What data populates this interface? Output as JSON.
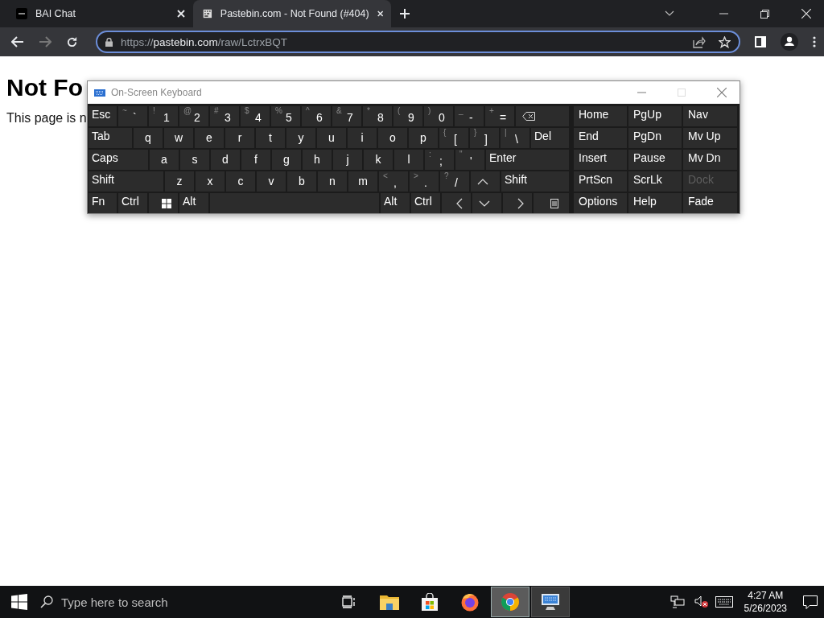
{
  "browser": {
    "tabs": [
      {
        "title": "BAI Chat",
        "selected": false
      },
      {
        "title": "Pastebin.com - Not Found (#404)",
        "selected": true
      }
    ],
    "address": {
      "scheme": "https://",
      "host": "pastebin.com",
      "path": "/raw/LctrxBQT"
    }
  },
  "page": {
    "heading": "Not Fo",
    "paragraph": "This page is n"
  },
  "keyboard": {
    "title": "On-Screen Keyboard",
    "maximize_disabled": true,
    "main_rows": [
      [
        {
          "kind": "text",
          "label": "Esc"
        },
        {
          "kind": "pair",
          "shift": "~",
          "label": "`"
        },
        {
          "kind": "pair",
          "shift": "!",
          "label": "1"
        },
        {
          "kind": "pair",
          "shift": "@",
          "label": "2"
        },
        {
          "kind": "pair",
          "shift": "#",
          "label": "3"
        },
        {
          "kind": "pair",
          "shift": "$",
          "label": "4"
        },
        {
          "kind": "pair",
          "shift": "%",
          "label": "5"
        },
        {
          "kind": "pair",
          "shift": "^",
          "label": "6"
        },
        {
          "kind": "pair",
          "shift": "&",
          "label": "7"
        },
        {
          "kind": "pair",
          "shift": "*",
          "label": "8"
        },
        {
          "kind": "pair",
          "shift": "(",
          "label": "9"
        },
        {
          "kind": "pair",
          "shift": ")",
          "label": "0"
        },
        {
          "kind": "pair",
          "shift": "_",
          "label": "-"
        },
        {
          "kind": "pair",
          "shift": "+",
          "label": "="
        },
        {
          "kind": "backspace"
        }
      ],
      [
        {
          "kind": "text",
          "label": "Tab"
        },
        {
          "kind": "letter",
          "label": "q"
        },
        {
          "kind": "letter",
          "label": "w"
        },
        {
          "kind": "letter",
          "label": "e"
        },
        {
          "kind": "letter",
          "label": "r"
        },
        {
          "kind": "letter",
          "label": "t"
        },
        {
          "kind": "letter",
          "label": "y"
        },
        {
          "kind": "letter",
          "label": "u"
        },
        {
          "kind": "letter",
          "label": "i"
        },
        {
          "kind": "letter",
          "label": "o"
        },
        {
          "kind": "letter",
          "label": "p"
        },
        {
          "kind": "pair",
          "shift": "{",
          "label": "["
        },
        {
          "kind": "pair",
          "shift": "}",
          "label": "]"
        },
        {
          "kind": "pair",
          "shift": "|",
          "label": "\\"
        },
        {
          "kind": "text",
          "label": "Del"
        }
      ],
      [
        {
          "kind": "text",
          "label": "Caps"
        },
        {
          "kind": "letter",
          "label": "a"
        },
        {
          "kind": "letter",
          "label": "s"
        },
        {
          "kind": "letter",
          "label": "d"
        },
        {
          "kind": "letter",
          "label": "f"
        },
        {
          "kind": "letter",
          "label": "g"
        },
        {
          "kind": "letter",
          "label": "h"
        },
        {
          "kind": "letter",
          "label": "j"
        },
        {
          "kind": "letter",
          "label": "k"
        },
        {
          "kind": "letter",
          "label": "l"
        },
        {
          "kind": "pair",
          "shift": ":",
          "label": ";"
        },
        {
          "kind": "pair",
          "shift": "\"",
          "label": "'"
        },
        {
          "kind": "text",
          "label": "Enter"
        }
      ],
      [
        {
          "kind": "text",
          "label": "Shift"
        },
        {
          "kind": "letter",
          "label": "z"
        },
        {
          "kind": "letter",
          "label": "x"
        },
        {
          "kind": "letter",
          "label": "c"
        },
        {
          "kind": "letter",
          "label": "v"
        },
        {
          "kind": "letter",
          "label": "b"
        },
        {
          "kind": "letter",
          "label": "n"
        },
        {
          "kind": "letter",
          "label": "m"
        },
        {
          "kind": "pair",
          "shift": "<",
          "label": ","
        },
        {
          "kind": "pair",
          "shift": ">",
          "label": "."
        },
        {
          "kind": "pair",
          "shift": "?",
          "label": "/"
        },
        {
          "kind": "up"
        },
        {
          "kind": "text",
          "label": "Shift"
        }
      ],
      [
        {
          "kind": "text",
          "label": "Fn"
        },
        {
          "kind": "text",
          "label": "Ctrl"
        },
        {
          "kind": "windows"
        },
        {
          "kind": "text",
          "label": "Alt"
        },
        {
          "kind": "space"
        },
        {
          "kind": "text",
          "label": "Alt"
        },
        {
          "kind": "text",
          "label": "Ctrl"
        },
        {
          "kind": "left"
        },
        {
          "kind": "down"
        },
        {
          "kind": "right"
        },
        {
          "kind": "menu"
        }
      ]
    ],
    "side_keys": [
      {
        "label": "Home",
        "disabled": false
      },
      {
        "label": "PgUp",
        "disabled": false
      },
      {
        "label": "Nav",
        "disabled": false
      },
      {
        "label": "End",
        "disabled": false
      },
      {
        "label": "PgDn",
        "disabled": false
      },
      {
        "label": "Mv Up",
        "disabled": false
      },
      {
        "label": "Insert",
        "disabled": false
      },
      {
        "label": "Pause",
        "disabled": false
      },
      {
        "label": "Mv Dn",
        "disabled": false
      },
      {
        "label": "PrtScn",
        "disabled": false
      },
      {
        "label": "ScrLk",
        "disabled": false
      },
      {
        "label": "Dock",
        "disabled": true
      },
      {
        "label": "Options",
        "disabled": false
      },
      {
        "label": "Help",
        "disabled": false
      },
      {
        "label": "Fade",
        "disabled": false
      }
    ]
  },
  "taskbar": {
    "search": {
      "placeholder": "Type here to search"
    },
    "apps": [
      {
        "kind": "task-view",
        "selected": false,
        "open": false
      },
      {
        "kind": "explorer",
        "selected": false,
        "open": false
      },
      {
        "kind": "store",
        "selected": false,
        "open": false
      },
      {
        "kind": "firefox",
        "selected": false,
        "open": false
      },
      {
        "kind": "chrome",
        "selected": true,
        "open": true
      },
      {
        "kind": "keyboard",
        "selected": false,
        "open": true
      }
    ],
    "volume_muted": true,
    "time": "4:27 AM",
    "date": "5/26/2023"
  }
}
